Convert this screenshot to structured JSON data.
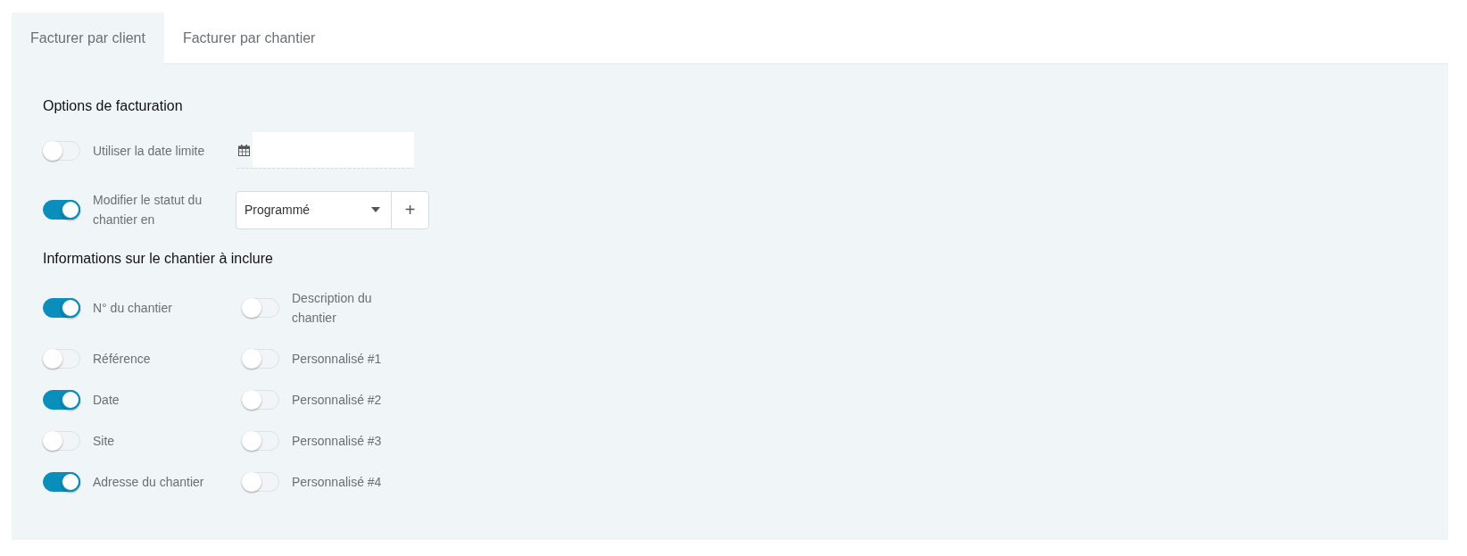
{
  "tabs": [
    {
      "label": "Facturer par client",
      "selected": true
    },
    {
      "label": "Facturer par chantier",
      "selected": false
    }
  ],
  "billing_options": {
    "title": "Options de facturation",
    "rows": [
      {
        "kind": "date",
        "label": "Utiliser la date limite",
        "on": false
      },
      {
        "kind": "status",
        "label": "Modifier le statut du chantier en",
        "on": true,
        "value": "Programmé",
        "add_label": "+"
      }
    ]
  },
  "include": {
    "title": "Informations sur le chantier à inclure",
    "rows": [
      [
        {
          "label": "N° du chantier",
          "on": true
        },
        {
          "label": "Description du chantier",
          "on": false
        }
      ],
      [
        {
          "label": "Référence",
          "on": false
        },
        {
          "label": "Personnalisé #1",
          "on": false
        }
      ],
      [
        {
          "label": "Date",
          "on": true
        },
        {
          "label": "Personnalisé #2",
          "on": false
        }
      ],
      [
        {
          "label": "Site",
          "on": false
        },
        {
          "label": "Personnalisé #3",
          "on": false
        }
      ],
      [
        {
          "label": "Adresse du chantier",
          "on": true
        },
        {
          "label": "Personnalisé #4",
          "on": false
        }
      ]
    ]
  }
}
